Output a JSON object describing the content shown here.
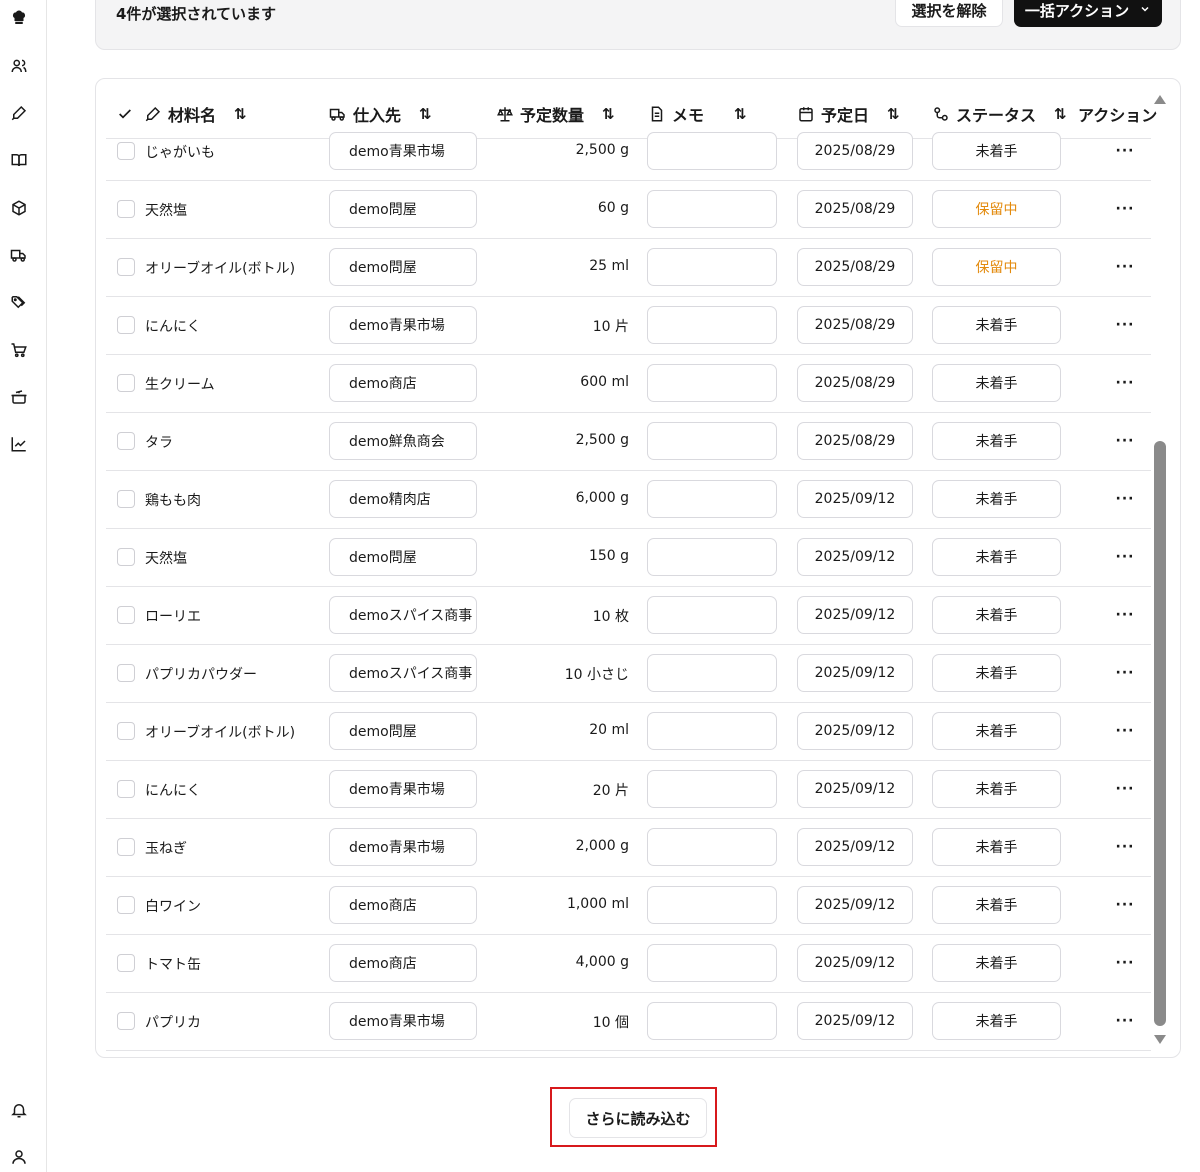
{
  "selection_bar": {
    "count_text": "4件が選択されています",
    "clear_label": "選択を解除",
    "bulk_label": "一括アクション"
  },
  "table": {
    "headers": {
      "material": "材料名",
      "supplier": "仕入先",
      "quantity": "予定数量",
      "memo": "メモ",
      "date": "予定日",
      "status": "ステータス",
      "action": "アクション",
      "sort_glyph": "⇅"
    },
    "rows": [
      {
        "material": "じゃがいも",
        "supplier": "demo青果市場",
        "quantity": "2,500 g",
        "date": "2025/08/29",
        "status": "未着手"
      },
      {
        "material": "天然塩",
        "supplier": "demo問屋",
        "quantity": "60 g",
        "date": "2025/08/29",
        "status": "保留中"
      },
      {
        "material": "オリーブオイル(ボトル)",
        "supplier": "demo問屋",
        "quantity": "25 ml",
        "date": "2025/08/29",
        "status": "保留中"
      },
      {
        "material": "にんにく",
        "supplier": "demo青果市場",
        "quantity": "10 片",
        "date": "2025/08/29",
        "status": "未着手"
      },
      {
        "material": "生クリーム",
        "supplier": "demo商店",
        "quantity": "600 ml",
        "date": "2025/08/29",
        "status": "未着手"
      },
      {
        "material": "タラ",
        "supplier": "demo鮮魚商会",
        "quantity": "2,500 g",
        "date": "2025/08/29",
        "status": "未着手"
      },
      {
        "material": "鶏もも肉",
        "supplier": "demo精肉店",
        "quantity": "6,000 g",
        "date": "2025/09/12",
        "status": "未着手"
      },
      {
        "material": "天然塩",
        "supplier": "demo問屋",
        "quantity": "150 g",
        "date": "2025/09/12",
        "status": "未着手"
      },
      {
        "material": "ローリエ",
        "supplier": "demoスパイス商事",
        "quantity": "10 枚",
        "date": "2025/09/12",
        "status": "未着手"
      },
      {
        "material": "パプリカパウダー",
        "supplier": "demoスパイス商事",
        "quantity": "10 小さじ",
        "date": "2025/09/12",
        "status": "未着手"
      },
      {
        "material": "オリーブオイル(ボトル)",
        "supplier": "demo問屋",
        "quantity": "20 ml",
        "date": "2025/09/12",
        "status": "未着手"
      },
      {
        "material": "にんにく",
        "supplier": "demo青果市場",
        "quantity": "20 片",
        "date": "2025/09/12",
        "status": "未着手"
      },
      {
        "material": "玉ねぎ",
        "supplier": "demo青果市場",
        "quantity": "2,000 g",
        "date": "2025/09/12",
        "status": "未着手"
      },
      {
        "material": "白ワイン",
        "supplier": "demo商店",
        "quantity": "1,000 ml",
        "date": "2025/09/12",
        "status": "未着手"
      },
      {
        "material": "トマト缶",
        "supplier": "demo商店",
        "quantity": "4,000 g",
        "date": "2025/09/12",
        "status": "未着手"
      },
      {
        "material": "パプリカ",
        "supplier": "demo青果市場",
        "quantity": "10 個",
        "date": "2025/09/12",
        "status": "未着手"
      }
    ],
    "more_glyph": "···"
  },
  "load_more_label": "さらに読み込む",
  "colors": {
    "hold_status": "#e38a0c",
    "highlight_frame": "#d7191c",
    "bulk_button_bg": "#111111"
  },
  "icons": {
    "rail": [
      "chef-hat-icon",
      "users-icon",
      "pen-icon",
      "book-icon",
      "package-icon",
      "truck-icon",
      "tags-icon",
      "cart-icon",
      "pot-icon",
      "chart-icon",
      "bell-icon",
      "user-icon"
    ]
  }
}
